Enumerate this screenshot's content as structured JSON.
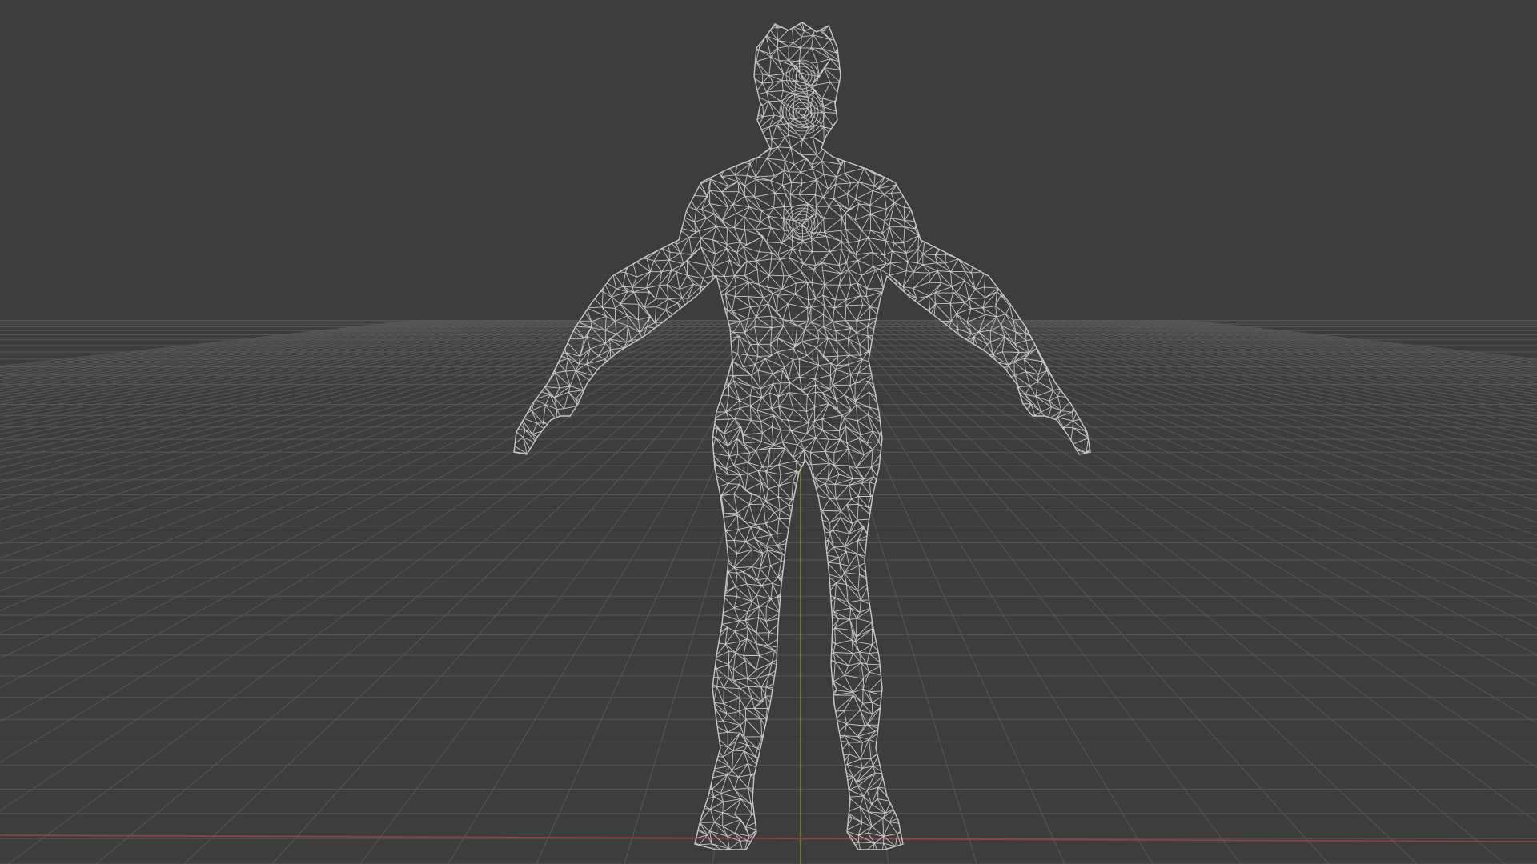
{
  "viewport": {
    "mode": "wireframe",
    "view": "front",
    "background_color": "#3d3d3d",
    "grid_color": "#575757",
    "x_axis_color": "#9a3f47",
    "z_axis_color": "#6a8a2c",
    "wire_color": "#c8c8c8",
    "floor_grid_visible": true
  },
  "object": {
    "kind": "humanoid-character-mesh",
    "pose": "A-pose",
    "display": "wireframe"
  }
}
